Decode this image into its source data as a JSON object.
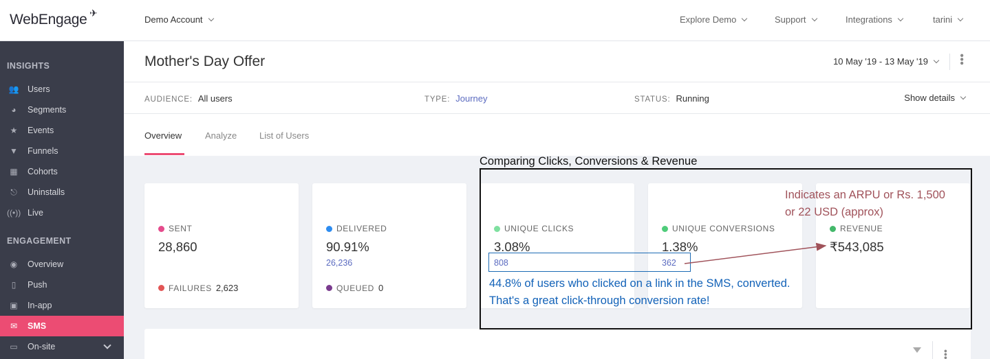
{
  "topbar": {
    "logo": "WebEngage",
    "account": "Demo Account",
    "nav": [
      {
        "label": "Explore Demo"
      },
      {
        "label": "Support"
      },
      {
        "label": "Integrations"
      },
      {
        "label": "tarini"
      }
    ]
  },
  "sidebar": {
    "insights_title": "INSIGHTS",
    "insights": [
      {
        "label": "Users",
        "icon": "users-icon"
      },
      {
        "label": "Segments",
        "icon": "pie-icon"
      },
      {
        "label": "Events",
        "icon": "star-icon"
      },
      {
        "label": "Funnels",
        "icon": "funnel-icon"
      },
      {
        "label": "Cohorts",
        "icon": "grid-icon"
      },
      {
        "label": "Uninstalls",
        "icon": "uninstall-icon"
      },
      {
        "label": "Live",
        "icon": "live-icon"
      }
    ],
    "engagement_title": "ENGAGEMENT",
    "engagement": [
      {
        "label": "Overview",
        "icon": "eye-icon"
      },
      {
        "label": "Push",
        "icon": "push-icon"
      },
      {
        "label": "In-app",
        "icon": "inapp-icon"
      },
      {
        "label": "SMS",
        "icon": "sms-icon",
        "active": true
      },
      {
        "label": "On-site",
        "icon": "onsite-icon"
      }
    ]
  },
  "header": {
    "title": "Mother's Day Offer",
    "date_range": "10 May '19 - 13 May '19",
    "audience_label": "AUDIENCE:",
    "audience_value": "All users",
    "type_label": "TYPE:",
    "type_value": "Journey",
    "status_label": "STATUS:",
    "status_value": "Running",
    "show_details": "Show details",
    "tabs": [
      {
        "label": "Overview",
        "active": true
      },
      {
        "label": "Analyze"
      },
      {
        "label": "List of Users"
      }
    ]
  },
  "cards": {
    "sent": {
      "label": "SENT",
      "value": "28,860",
      "sub_label": "FAILURES",
      "sub_value": "2,623",
      "color": "#e54b8c",
      "sub_color": "#e25555"
    },
    "delivered": {
      "label": "DELIVERED",
      "value": "90.91%",
      "sub": "26,236",
      "sub_label": "QUEUED",
      "sub_value": "0",
      "color": "#2d8cf0",
      "sub_color": "#7a3b8e"
    },
    "clicks": {
      "label": "UNIQUE CLICKS",
      "value": "3.08%",
      "sub": "808",
      "color": "#7fe0a0"
    },
    "conversions": {
      "label": "UNIQUE CONVERSIONS",
      "value": "1.38%",
      "sub": "362",
      "color": "#4fcc7a"
    },
    "revenue": {
      "label": "REVENUE",
      "value": "₹543,085",
      "color": "#43b86a"
    }
  },
  "annotations": {
    "box_title": "Comparing Clicks, Conversions & Revenue",
    "arpu_line1": "Indicates an ARPU or Rs. 1,500",
    "arpu_line2": "or 22 USD (approx)",
    "conv_line1": "44.8% of users who clicked on a link in the SMS, converted.",
    "conv_line2": "That's a great click-through conversion rate!"
  }
}
